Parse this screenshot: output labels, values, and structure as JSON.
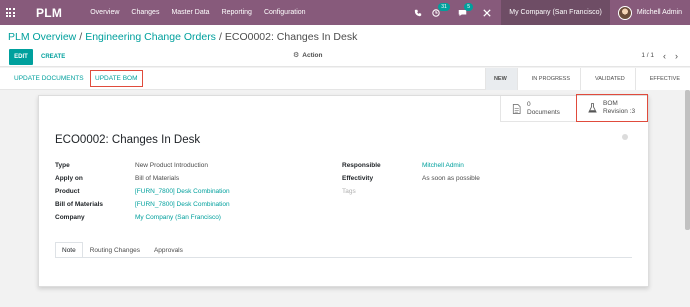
{
  "navbar": {
    "brand": "PLM",
    "menu": [
      "Overview",
      "Changes",
      "Master Data",
      "Reporting",
      "Configuration"
    ],
    "activity_count": "31",
    "message_count": "5",
    "company": "My Company (San Francisco)",
    "user": "Mitchell Admin"
  },
  "breadcrumb": {
    "crumb1": "PLM Overview",
    "crumb2": "Engineering Change Orders",
    "current": "ECO0002: Changes In Desk",
    "separator": "/"
  },
  "toolbar": {
    "edit": "EDIT",
    "create": "CREATE",
    "action": "Action",
    "pager": "1 / 1"
  },
  "header_buttons": {
    "update_documents": "UPDATE DOCUMENTS",
    "update_bom": "UPDATE BOM"
  },
  "stages": [
    "NEW",
    "IN PROGRESS",
    "VALIDATED",
    "EFFECTIVE"
  ],
  "active_stage": "NEW",
  "stat_buttons": {
    "documents_count": "0",
    "documents_label": "Documents",
    "bom_label": "BOM",
    "bom_revision": "Revision :3"
  },
  "record": {
    "title": "ECO0002: Changes In Desk",
    "left_fields": [
      {
        "label": "Type",
        "value": "New Product Introduction"
      },
      {
        "label": "Apply on",
        "value": "Bill of Materials"
      },
      {
        "label": "Product",
        "value": "[FURN_7800] Desk Combination"
      },
      {
        "label": "Bill of Materials",
        "value": "[FURN_7800] Desk Combination"
      },
      {
        "label": "Company",
        "value": "My Company (San Francisco)"
      }
    ],
    "right_fields": [
      {
        "label": "Responsible",
        "value": "Mitchell Admin"
      },
      {
        "label": "Effectivity",
        "value": "As soon as possible"
      },
      {
        "label": "Tags",
        "value": ""
      }
    ]
  },
  "tabs": [
    "Note",
    "Routing Changes",
    "Approvals"
  ],
  "colors": {
    "brand": "#875a7b",
    "accent": "#00a09d",
    "highlight": "#e04b3c"
  }
}
